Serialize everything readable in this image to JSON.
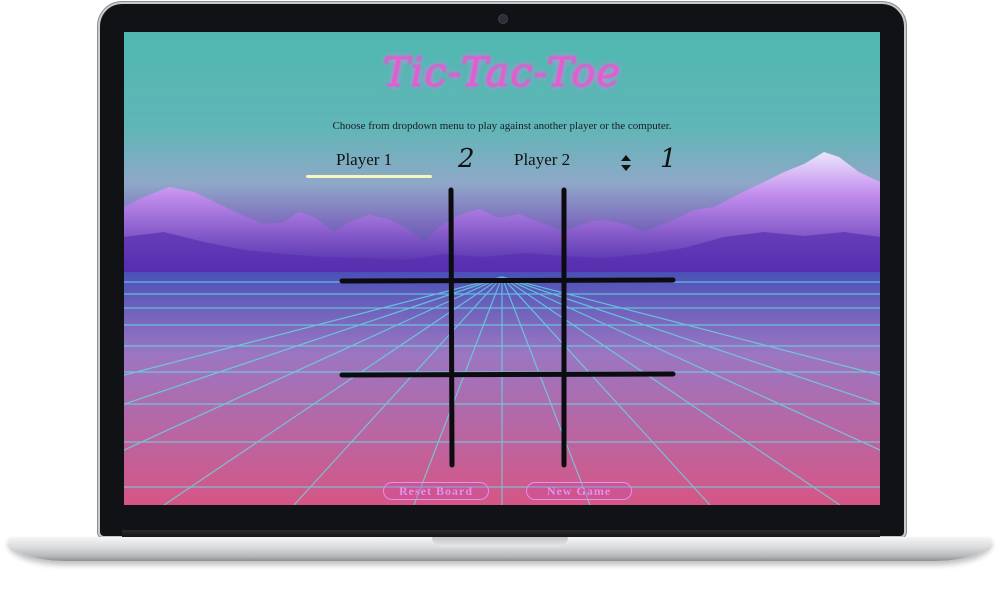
{
  "game": {
    "title": "Tic-Tac-Toe",
    "subtitle": "Choose from dropdown menu to play against another player or the computer."
  },
  "players": {
    "player1": {
      "label": "Player 1",
      "score": "2"
    },
    "player2": {
      "label": "Player 2",
      "score": "1"
    }
  },
  "buttons": {
    "reset": "Reset Board",
    "new_game": "New Game"
  },
  "colors": {
    "title": "#e25ecf",
    "grid_line": "#0c0c10",
    "button_text": "#e48fe9",
    "underline": "#f6f7b8"
  },
  "icons": {
    "selector": "sort-updown-icon"
  }
}
